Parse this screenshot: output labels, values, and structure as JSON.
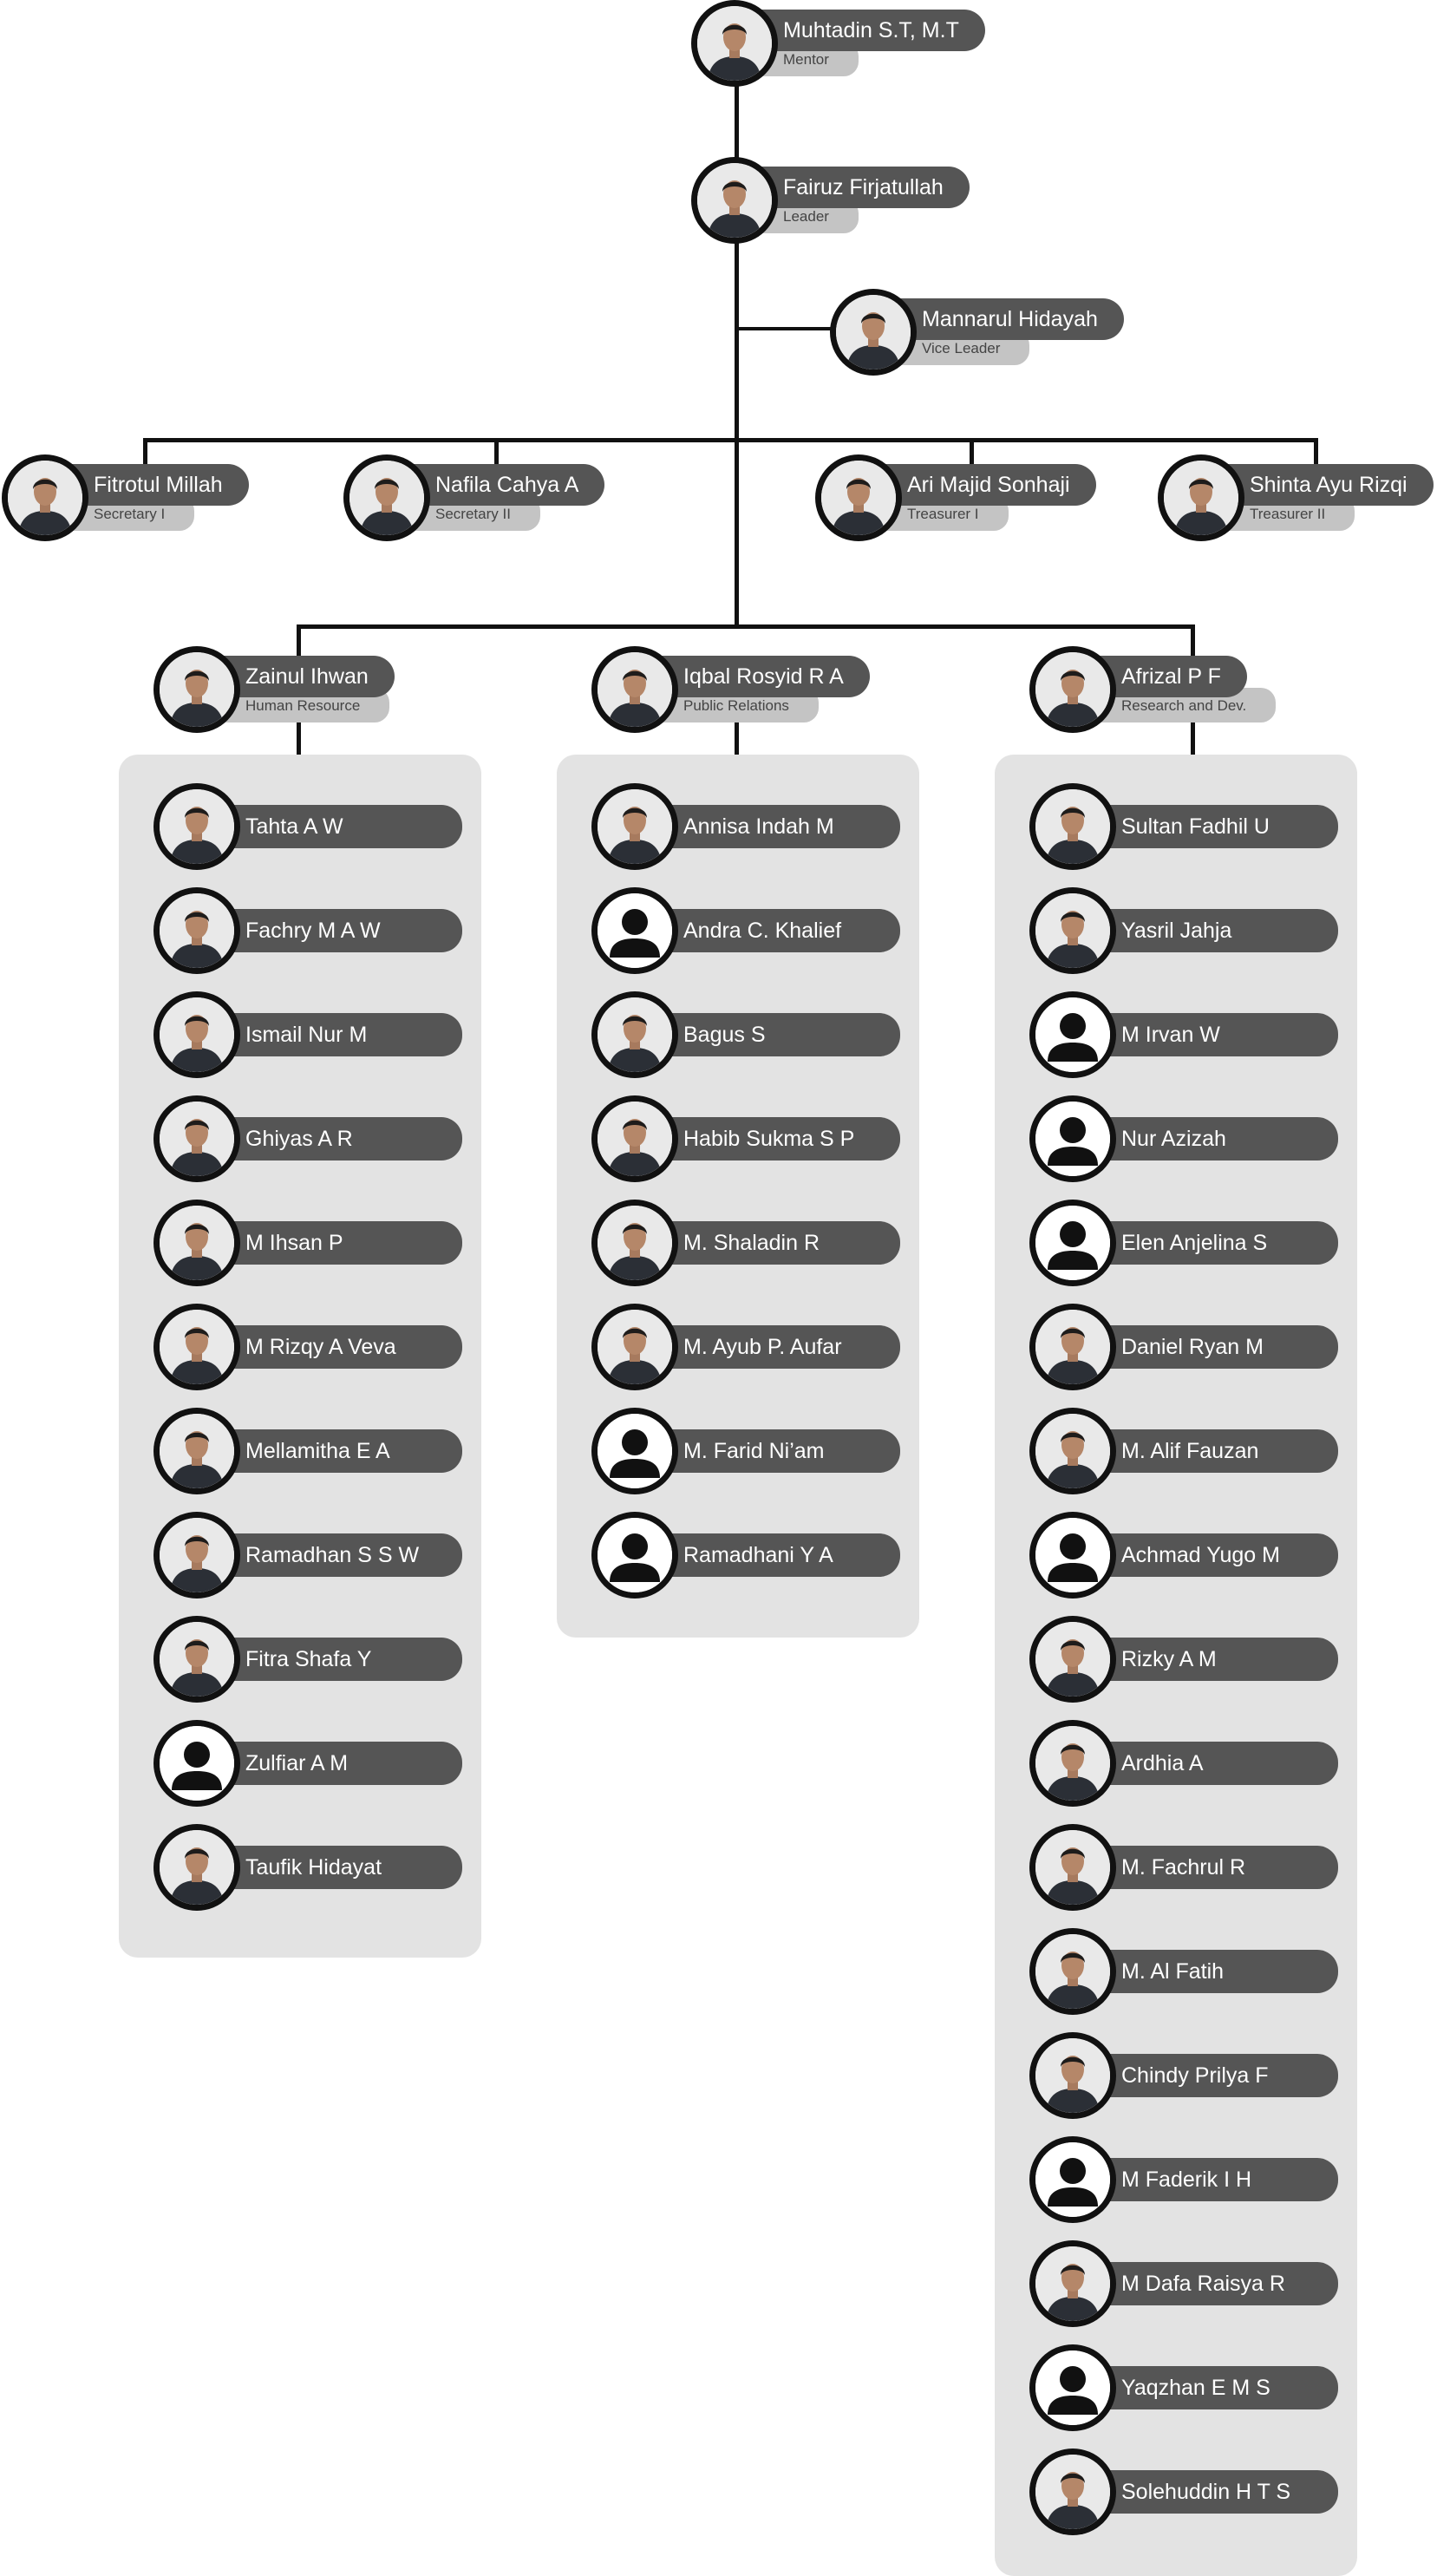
{
  "mentor": {
    "name": "Muhtadin S.T, M.T",
    "role": "Mentor",
    "photo": "portrait-photo"
  },
  "leader": {
    "name": "Fairuz Firjatullah",
    "role": "Leader",
    "photo": "portrait-photo"
  },
  "vice_leader": {
    "name": "Mannarul Hidayah",
    "role": "Vice Leader",
    "photo": "portrait-photo"
  },
  "officers": [
    {
      "name": "Fitrotul Millah",
      "role": "Secretary I",
      "photo": "portrait-photo"
    },
    {
      "name": "Nafila Cahya A",
      "role": "Secretary II",
      "photo": "portrait-photo"
    },
    {
      "name": "Ari Majid Sonhaji",
      "role": "Treasurer I",
      "photo": "portrait-photo"
    },
    {
      "name": "Shinta Ayu Rizqi",
      "role": "Treasurer II",
      "photo": "portrait-photo"
    }
  ],
  "divisions": [
    {
      "head": {
        "name": "Zainul Ihwan",
        "role": "Human Resource",
        "photo": "portrait-photo"
      },
      "members": [
        {
          "name": "Tahta A W",
          "photo": "portrait-photo"
        },
        {
          "name": "Fachry M A W",
          "photo": "portrait-photo"
        },
        {
          "name": "Ismail Nur M",
          "photo": "portrait-photo"
        },
        {
          "name": "Ghiyas A R",
          "photo": "portrait-photo"
        },
        {
          "name": "M Ihsan P",
          "photo": "portrait-photo"
        },
        {
          "name": "M Rizqy A Veva",
          "photo": "portrait-photo"
        },
        {
          "name": "Mellamitha E A",
          "photo": "portrait-photo"
        },
        {
          "name": "Ramadhan S S W",
          "photo": "portrait-photo"
        },
        {
          "name": "Fitra Shafa Y",
          "photo": "portrait-photo"
        },
        {
          "name": "Zulfiar A M",
          "photo": "default-avatar-icon"
        },
        {
          "name": "Taufik Hidayat",
          "photo": "portrait-photo"
        }
      ]
    },
    {
      "head": {
        "name": "Iqbal Rosyid R A",
        "role": "Public Relations",
        "photo": "portrait-photo"
      },
      "members": [
        {
          "name": "Annisa Indah M",
          "photo": "portrait-photo"
        },
        {
          "name": "Andra C. Khalief",
          "photo": "default-avatar-icon"
        },
        {
          "name": "Bagus S",
          "photo": "portrait-photo"
        },
        {
          "name": "Habib Sukma S P",
          "photo": "portrait-photo"
        },
        {
          "name": "M. Shaladin R",
          "photo": "portrait-photo"
        },
        {
          "name": "M. Ayub P. Aufar",
          "photo": "portrait-photo"
        },
        {
          "name": "M. Farid Ni’am",
          "photo": "default-avatar-icon"
        },
        {
          "name": "Ramadhani Y A",
          "photo": "default-avatar-icon"
        }
      ]
    },
    {
      "head": {
        "name": "Afrizal P F",
        "role": "Research and Dev.",
        "photo": "portrait-photo"
      },
      "members": [
        {
          "name": "Sultan Fadhil U",
          "photo": "portrait-photo"
        },
        {
          "name": "Yasril Jahja",
          "photo": "portrait-photo"
        },
        {
          "name": "M Irvan W",
          "photo": "default-avatar-icon"
        },
        {
          "name": "Nur Azizah",
          "photo": "default-avatar-icon"
        },
        {
          "name": "Elen Anjelina S",
          "photo": "default-avatar-icon"
        },
        {
          "name": "Daniel Ryan M",
          "photo": "portrait-photo"
        },
        {
          "name": "M. Alif Fauzan",
          "photo": "portrait-photo"
        },
        {
          "name": "Achmad Yugo M",
          "photo": "default-avatar-icon"
        },
        {
          "name": "Rizky A M",
          "photo": "portrait-photo"
        },
        {
          "name": "Ardhia A",
          "photo": "portrait-photo"
        },
        {
          "name": "M. Fachrul R",
          "photo": "portrait-photo"
        },
        {
          "name": "M. Al Fatih",
          "photo": "portrait-photo"
        },
        {
          "name": "Chindy Prilya F",
          "photo": "portrait-photo"
        },
        {
          "name": "M Faderik I H",
          "photo": "default-avatar-icon"
        },
        {
          "name": "M Dafa Raisya R",
          "photo": "portrait-photo"
        },
        {
          "name": "Yaqzhan E M S",
          "photo": "default-avatar-icon"
        },
        {
          "name": "Solehuddin H T S",
          "photo": "portrait-photo"
        }
      ]
    }
  ]
}
